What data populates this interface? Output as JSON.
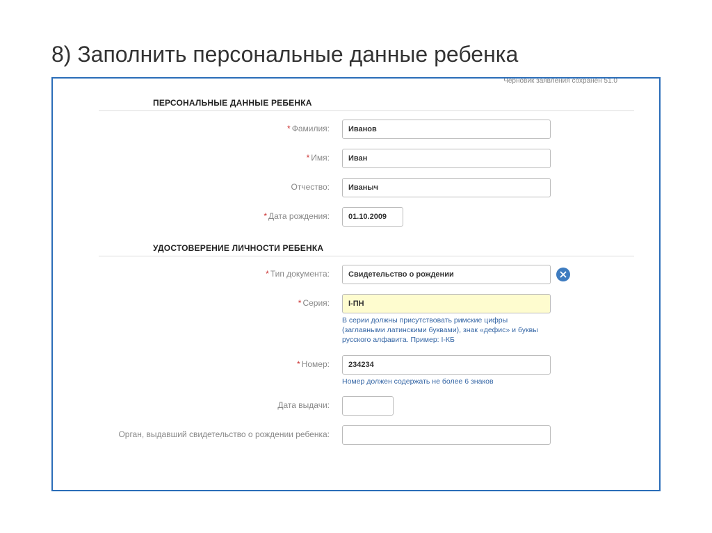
{
  "slide": {
    "title": "8) Заполнить персональные данные ребенка"
  },
  "draftNote": "Черновик заявления сохранен 51.0",
  "sections": {
    "personal": {
      "heading": "ПЕРСОНАЛЬНЫЕ ДАННЫЕ РЕБЕНКА",
      "fields": {
        "surname": {
          "label": "Фамилия:",
          "value": "Иванов"
        },
        "name": {
          "label": "Имя:",
          "value": "Иван"
        },
        "patronymic": {
          "label": "Отчество:",
          "value": "Иваныч"
        },
        "birthdate": {
          "label": "Дата рождения:",
          "value": "01.10.2009"
        }
      }
    },
    "identity": {
      "heading": "УДОСТОВЕРЕНИЕ ЛИЧНОСТИ РЕБЕНКА",
      "fields": {
        "doctype": {
          "label": "Тип документа:",
          "value": "Свидетельство о рождении"
        },
        "series": {
          "label": "Серия:",
          "value": "I-ПН",
          "hint": "В серии должны присутствовать римские цифры (заглавными латинскими буквами), знак «дефис» и буквы русского алфавита. Пример: I-КБ"
        },
        "number": {
          "label": "Номер:",
          "value": "234234",
          "hint": "Номер должен содержать не более 6 знаков"
        },
        "issuedate": {
          "label": "Дата выдачи:",
          "value": ""
        },
        "issuer": {
          "label": "Орган, выдавший свидетельство о рождении ребенка:",
          "value": ""
        }
      }
    }
  }
}
